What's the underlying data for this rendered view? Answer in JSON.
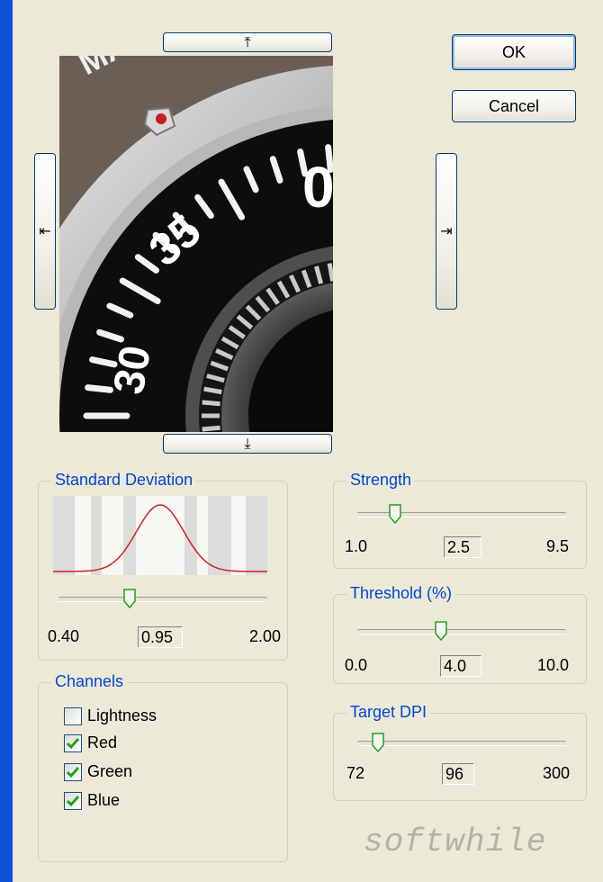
{
  "buttons": {
    "ok": "OK",
    "cancel": "Cancel",
    "move_up": "⤒",
    "move_down": "⤓",
    "move_left": "⇤",
    "move_right": "⇥"
  },
  "preview": {
    "dial_numbers": [
      "0",
      "35",
      "30"
    ],
    "dial_letters": "MAS"
  },
  "standard_deviation": {
    "title": "Standard Deviation",
    "min": "0.40",
    "value": "0.95",
    "max": "2.00",
    "level": 0.34
  },
  "strength": {
    "title": "Strength",
    "min": "1.0",
    "value": "2.5",
    "max": "9.5",
    "level": 0.18
  },
  "threshold": {
    "title": "Threshold (%)",
    "min": "0.0",
    "value": "4.0",
    "max": "10.0",
    "level": 0.4
  },
  "target_dpi": {
    "title": "Target DPI",
    "min": "72",
    "value": "96",
    "max": "300",
    "level": 0.1
  },
  "channels": {
    "title": "Channels",
    "items": [
      {
        "label": "Lightness",
        "checked": false
      },
      {
        "label": "Red",
        "checked": true
      },
      {
        "label": "Green",
        "checked": true
      },
      {
        "label": "Blue",
        "checked": true
      }
    ]
  },
  "brand": "softwhile",
  "colors": {
    "frame": "#0a50d8",
    "dialog_bg": "#ece9d8",
    "group_title": "#0046d5",
    "curve": "#d02020",
    "check": "#21a121",
    "thumb_accent": "#21a121"
  }
}
